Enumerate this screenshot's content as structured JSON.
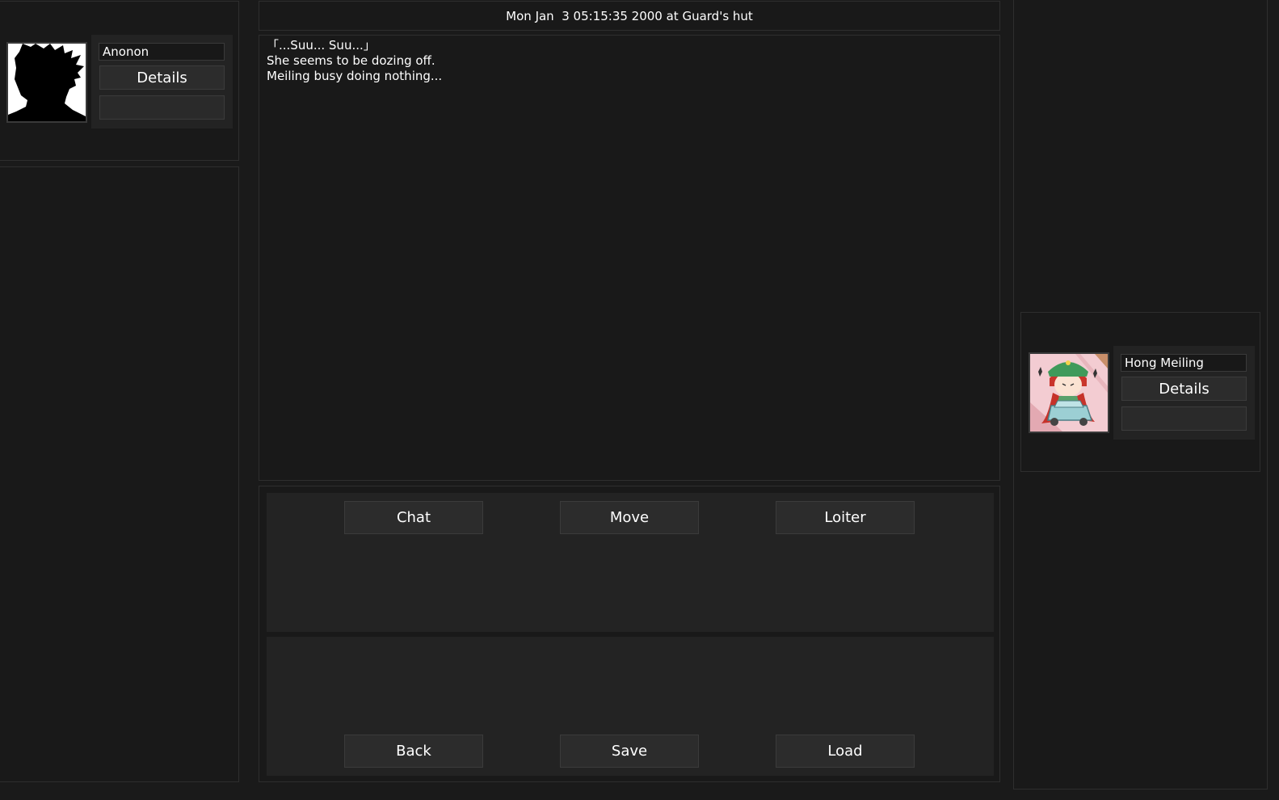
{
  "header": {
    "datetime_location": "Mon Jan  3 05:15:35 2000 at Guard's hut"
  },
  "player": {
    "name": "Anonon",
    "details_label": "Details",
    "portrait_icon": "silhouette-portrait"
  },
  "npc": {
    "name": "Hong Meiling",
    "details_label": "Details",
    "portrait_icon": "hong-meiling-portrait"
  },
  "log": {
    "lines": [
      "「...Suu... Suu...」",
      "She seems to be dozing off.",
      "",
      "Meiling busy doing nothing..."
    ]
  },
  "actions": {
    "chat": "Chat",
    "move": "Move",
    "loiter": "Loiter"
  },
  "system": {
    "back": "Back",
    "save": "Save",
    "load": "Load"
  },
  "colors": {
    "background": "#1a1a1a",
    "panel": "#191919",
    "panel_border": "#2e2e2e",
    "inner_panel": "#232323",
    "button": "#2c2c2c",
    "text": "#ffffff"
  }
}
